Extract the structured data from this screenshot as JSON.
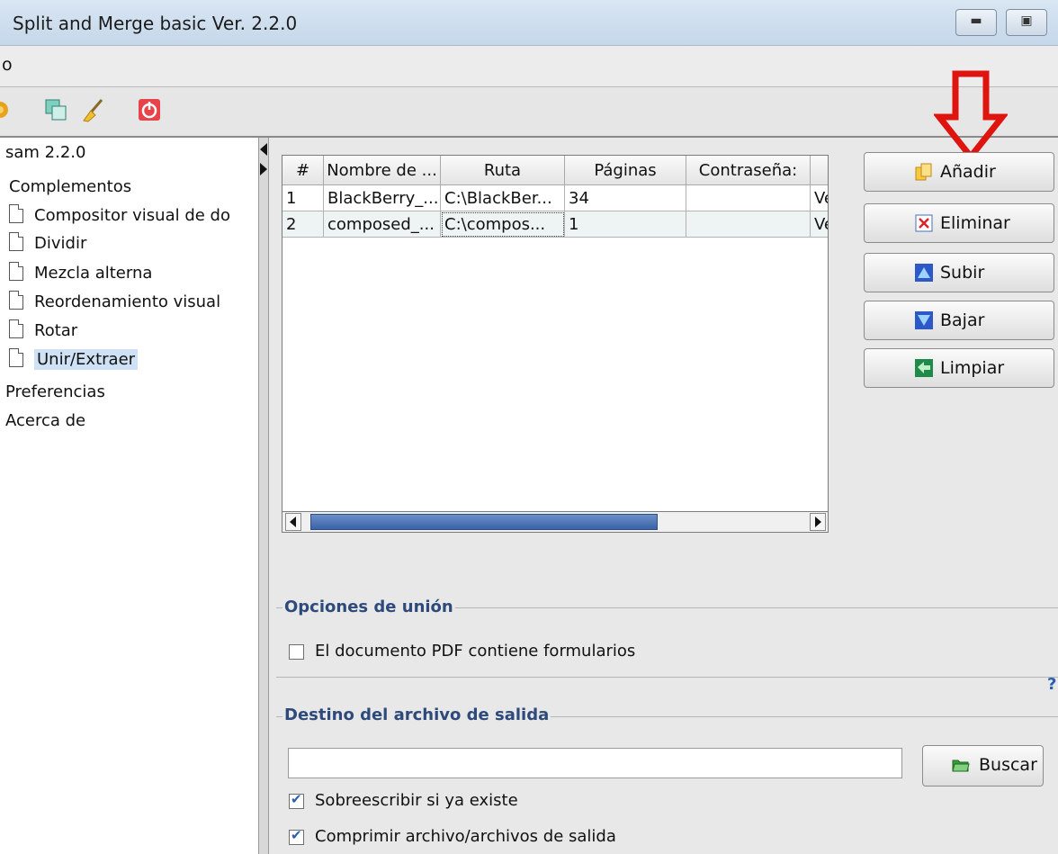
{
  "window": {
    "title": "Split and Merge basic Ver. 2.2.0",
    "minimize_icon": "minimize-icon",
    "maximize_icon": "maximize-icon"
  },
  "menu": {
    "items": [
      "o"
    ]
  },
  "toolbar": {
    "icons": [
      "plugin-icon",
      "copy-icon",
      "broom-icon",
      "power-icon"
    ]
  },
  "tree": {
    "root": "sam 2.2.0",
    "group": "Complementos",
    "items": [
      "Compositor visual de do",
      "Dividir",
      "Mezcla alterna",
      "Reordenamiento visual",
      "Rotar",
      "Unir/Extraer"
    ],
    "selected": "Unir/Extraer",
    "extra": [
      "Preferencias",
      "Acerca de"
    ]
  },
  "table": {
    "columns": [
      "#",
      "Nombre de ...",
      "Ruta",
      "Páginas",
      "Contraseña:",
      ""
    ],
    "rows": [
      [
        "1",
        "BlackBerry_...",
        "C:\\BlackBer...",
        "34",
        "",
        "Ve"
      ],
      [
        "2",
        "composed_...",
        "C:\\compos...",
        "1",
        "",
        "Ve"
      ]
    ]
  },
  "actions": {
    "add": "Añadir",
    "remove": "Eliminar",
    "up": "Subir",
    "down": "Bajar",
    "clear": "Limpiar"
  },
  "merge_options": {
    "title": "Opciones de unión",
    "forms_label": "El documento PDF contiene formularios",
    "forms_checked": false,
    "help": "?"
  },
  "output": {
    "title": "Destino del archivo de salida",
    "path_value": "",
    "browse": "Buscar",
    "overwrite_label": "Sobreescribir si ya existe",
    "overwrite_checked": true,
    "compress_label": "Comprimir archivo/archivos de salida",
    "compress_checked": true
  },
  "colors": {
    "annotation_arrow": "#e0140f",
    "selection": "#cfe1f5",
    "group_title": "#2e4a7a"
  }
}
